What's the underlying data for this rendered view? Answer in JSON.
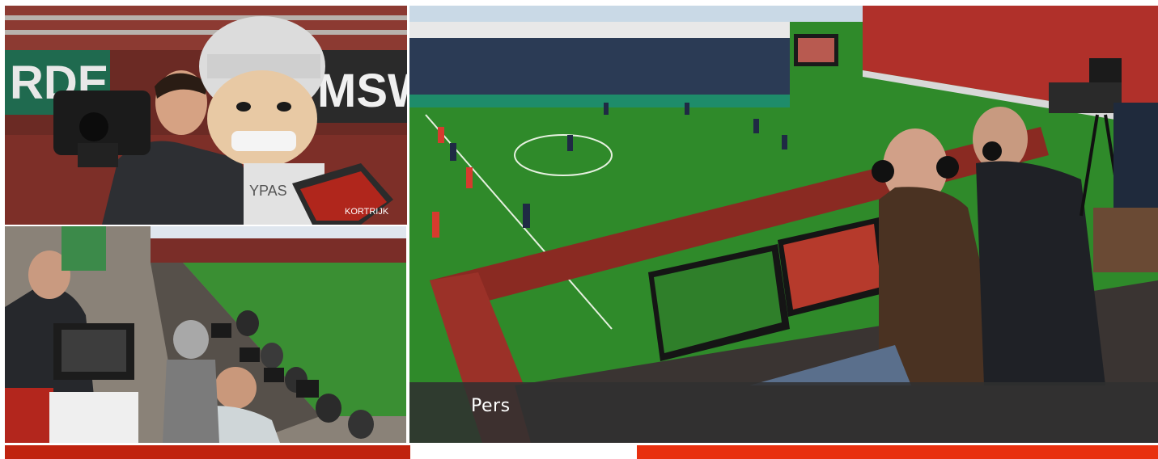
{
  "tiles": {
    "camera": {
      "banner_left": "RDE",
      "banner_right": "MSWI",
      "sign_text": "KORTRIJK",
      "mascot_text": "YPAS"
    },
    "press": {},
    "stadium": {
      "caption": "Pers"
    }
  },
  "colors": {
    "bar_left": "#c0230f",
    "bar_right": "#e8300f",
    "caption_bg": "#303030",
    "pitch": "#2f8a2a"
  }
}
